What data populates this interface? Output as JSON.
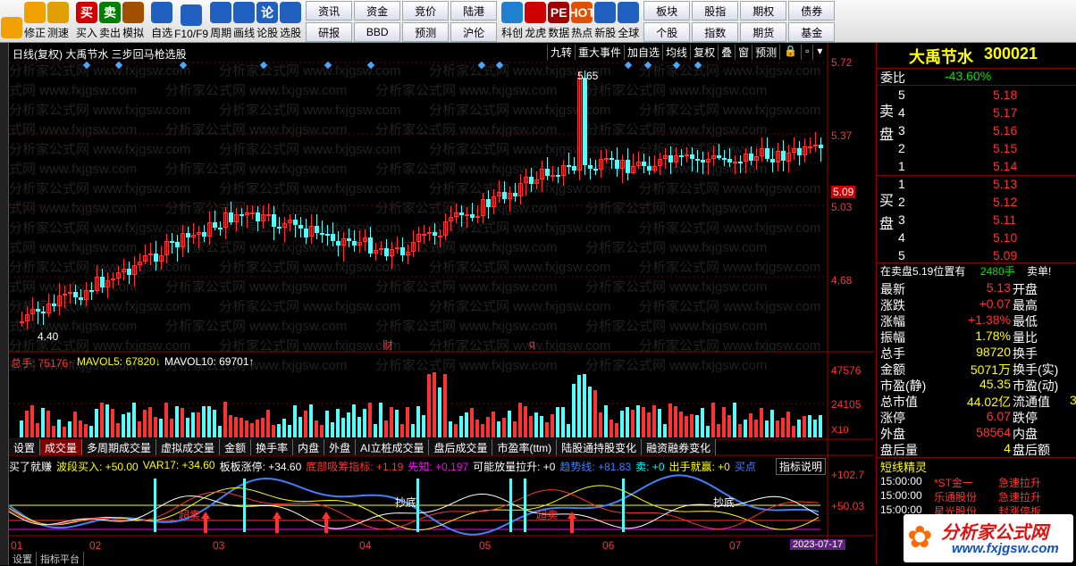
{
  "toolbar": {
    "left": [
      {
        "label": "",
        "icon": "back-arrow-icon",
        "color": "#f0a000"
      },
      {
        "label": "修正",
        "icon": "up-down-arrow-icon",
        "color": "#f0a000"
      },
      {
        "label": "测速",
        "icon": "speed-icon",
        "color": "#e0a000"
      },
      {
        "label": "买入",
        "icon": "buy-icon",
        "glyph": "买",
        "color": "#d00000"
      },
      {
        "label": "卖出",
        "icon": "sell-icon",
        "glyph": "卖",
        "color": "#008000"
      },
      {
        "label": "模拟",
        "icon": "hammer-icon",
        "color": "#a05000"
      },
      {
        "label": "自选",
        "icon": "star-icon",
        "color": "#2060c0"
      },
      {
        "label": "F10/F9",
        "icon": "f10-icon",
        "color": "#2060c0"
      },
      {
        "label": "周期",
        "icon": "cycle-icon",
        "color": "#2060c0"
      },
      {
        "label": "画线",
        "icon": "pencil-icon",
        "color": "#2060c0"
      },
      {
        "label": "论股",
        "icon": "discuss-icon",
        "glyph": "论",
        "color": "#2060c0"
      },
      {
        "label": "选股",
        "icon": "select-stock-icon",
        "color": "#2060c0"
      }
    ],
    "grid": [
      "资讯",
      "资金",
      "竞价",
      "陆港",
      "研报",
      "BBD",
      "预测",
      "沪伦"
    ],
    "right": [
      {
        "label": "科创",
        "icon": "kechuang-icon",
        "color": "#2080d0"
      },
      {
        "label": "龙虎",
        "icon": "dragon-tiger-icon",
        "color": "#d00000"
      },
      {
        "label": "数据",
        "icon": "pe-data-icon",
        "glyph": "PE",
        "color": "#a00000"
      },
      {
        "label": "热点",
        "icon": "hot-icon",
        "glyph": "HOT",
        "color": "#e05000"
      },
      {
        "label": "新股",
        "icon": "new-stock-icon",
        "color": "#2060c0"
      },
      {
        "label": "全球",
        "icon": "globe-icon",
        "color": "#2060c0"
      }
    ],
    "grid2": [
      "板块",
      "股指",
      "期权",
      "债券",
      "个股",
      "指数",
      "期货",
      "基金"
    ]
  },
  "chart_title": "日线(复权)  大禹节水  三步回马枪选股",
  "toolbar_chart": [
    "九转",
    "重大事件",
    "加自选",
    "均线",
    "复权",
    "叠",
    "窗",
    "预测"
  ],
  "price_axis": [
    "5.72",
    "5.37",
    "5.09",
    "5.03",
    "4.68"
  ],
  "price_high_label": "5.65",
  "price_low_label": "4.40",
  "event_marks": [
    "财",
    "q"
  ],
  "volume_legend": {
    "total": "总手: 75176↑",
    "mavol5": "MAVOL5: 67820↓",
    "mavol10": "MAVOL10: 69701↑"
  },
  "volume_axis": [
    "47576",
    "24105",
    "X10"
  ],
  "tabs": [
    "设置",
    "成交量",
    "多周期成交量",
    "虚拟成交量",
    "金额",
    "换手率",
    "内盘",
    "外盘",
    "AI立桩成交量",
    "盘后成交量",
    "市盈率(ttm)",
    "陆股通持股变化",
    "融资融券变化"
  ],
  "indicator_legend": [
    {
      "text": "买了就赚",
      "color": "#ffffff"
    },
    {
      "text": "波段买入: +50.00",
      "color": "#ffff00"
    },
    {
      "text": "VAR17: +34.60",
      "color": "#ffff00"
    },
    {
      "text": "板板涨停: +34.60",
      "color": "#ffffff"
    },
    {
      "text": "底部吸筹指标: +1.19",
      "color": "#ff3232"
    },
    {
      "text": "先知: +0.197",
      "color": "#ff00ff"
    },
    {
      "text": "可能放量拉升: +0",
      "color": "#ffffff"
    },
    {
      "text": "趋势线: +81.83",
      "color": "#4080ff"
    },
    {
      "text": "卖: +0",
      "color": "#00ffff"
    },
    {
      "text": "出手就赢: +0",
      "color": "#ffff00"
    },
    {
      "text": "买点",
      "color": "#4080ff"
    }
  ],
  "indicator_help": "指标说明",
  "indicator_axis": [
    "+102.7",
    "+50.03"
  ],
  "indicator_marks": {
    "chaodi": "抄底",
    "chaomai": "超卖"
  },
  "time_axis": [
    "01",
    "02",
    "03",
    "04",
    "05",
    "06",
    "07"
  ],
  "date_box": "2023-07-17",
  "quote": {
    "name": "大禹节水",
    "code": "300021",
    "weibi_label": "委比",
    "weibi": "-43.60%",
    "sell_label": "卖盘",
    "buy_label": "买盘",
    "sell": [
      {
        "lvl": "5",
        "price": "5.18"
      },
      {
        "lvl": "4",
        "price": "5.17"
      },
      {
        "lvl": "3",
        "price": "5.16"
      },
      {
        "lvl": "2",
        "price": "5.15"
      },
      {
        "lvl": "1",
        "price": "5.14"
      }
    ],
    "buy": [
      {
        "lvl": "1",
        "price": "5.13"
      },
      {
        "lvl": "2",
        "price": "5.12"
      },
      {
        "lvl": "3",
        "price": "5.11"
      },
      {
        "lvl": "4",
        "price": "5.10"
      },
      {
        "lvl": "5",
        "price": "5.09"
      }
    ],
    "notice": "在卖盘5.19位置有",
    "notice_vol": "2480手",
    "notice_tail": "卖单!",
    "stats_left": [
      {
        "k": "最新",
        "v": "5.13",
        "c": "#ff3232"
      },
      {
        "k": "涨跌",
        "v": "+0.07",
        "c": "#ff3232"
      },
      {
        "k": "涨幅",
        "v": "+1.38%",
        "c": "#ff3232"
      },
      {
        "k": "振幅",
        "v": "1.78%",
        "c": "#ffff00"
      },
      {
        "k": "总手",
        "v": "98720",
        "c": "#ffff00"
      },
      {
        "k": "金额",
        "v": "5071万",
        "c": "#ffff00"
      },
      {
        "k": "市盈(静)",
        "v": "45.35",
        "c": "#ffff00"
      },
      {
        "k": "总市值",
        "v": "44.02亿",
        "c": "#ffff00"
      },
      {
        "k": "涨停",
        "v": "6.07",
        "c": "#ff3232"
      },
      {
        "k": "外盘",
        "v": "58564",
        "c": "#ff3232"
      },
      {
        "k": "盘后量",
        "v": "4",
        "c": "#ffff00"
      }
    ],
    "stats_right": [
      "开盘",
      "最高",
      "最低",
      "量比",
      "换手",
      "换手(实)",
      "市盈(动)",
      "流通值",
      "跌停",
      "内盘",
      "盘后额"
    ],
    "stats_right_vals": [
      "",
      "",
      "",
      "",
      "",
      "",
      "",
      "3",
      "",
      "",
      ""
    ]
  },
  "short_title": "短线精灵",
  "shorts": [
    {
      "t": "15:00:00",
      "name": "*ST金一",
      "act": "急速拉升"
    },
    {
      "t": "15:00:00",
      "name": "乐通股份",
      "act": "急速拉升"
    },
    {
      "t": "15:00:00",
      "name": "星光股份",
      "act": "封涨停板"
    }
  ],
  "bottom_tabs": [
    "设置",
    "指标平台"
  ],
  "watermark": "分析家公式网 www.fxjgsw.com",
  "logo_text": "分析家公式网",
  "logo_url": "www.fxjgsw.com",
  "colors": {
    "up": "#ff3232",
    "down": "#54fcfc",
    "accent": "#ffff00"
  }
}
